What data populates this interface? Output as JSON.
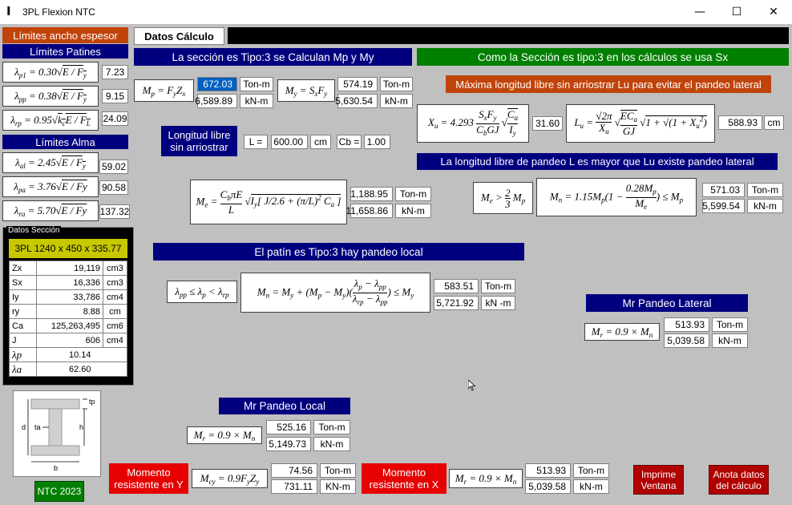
{
  "window": {
    "title": "3PL Flexion NTC",
    "minimize": "—",
    "maximize": "☐",
    "close": "✕"
  },
  "left": {
    "limits_header": "Límites ancho espesor",
    "patines_header": "Límites Patines",
    "alma_header": "Límites Alma",
    "patines": [
      {
        "formula": "λp1 = 0.30√(E / Fy)",
        "value": "7.23"
      },
      {
        "formula": "λpp = 0.38√(E / Fy)",
        "value": "9.15"
      },
      {
        "formula": "λrp = 0.95√(kc E / FL)",
        "value": "24.09"
      }
    ],
    "alma": [
      {
        "formula": "λal = 2.45√(E / Fy)",
        "value": "59.02"
      },
      {
        "formula": "λpa = 3.76√(E / Fy)",
        "value": "90.58"
      },
      {
        "formula": "λra = 5.70√(E / Fy)",
        "value": "137.32"
      }
    ],
    "section_panel_label": "Datos Sección",
    "section_name": "3PL 1240 x 450 x 335.77",
    "props": [
      {
        "name": "Zx",
        "value": "19,119",
        "unit": "cm3"
      },
      {
        "name": "Sx",
        "value": "16,336",
        "unit": "cm3"
      },
      {
        "name": "Iy",
        "value": "33,786",
        "unit": "cm4"
      },
      {
        "name": "ry",
        "value": "8.88",
        "unit": "cm"
      },
      {
        "name": "Ca",
        "value": "125,263,495",
        "unit": "cm6"
      },
      {
        "name": "J",
        "value": "606",
        "unit": "cm4"
      },
      {
        "name": "λp",
        "value": "10.14",
        "unit": ""
      },
      {
        "name": "λa",
        "value": "62.60",
        "unit": ""
      }
    ],
    "diagram_labels": {
      "tp": "tp",
      "d": "d",
      "ta": "ta",
      "h": "h",
      "b": "b"
    },
    "ntc_label": "NTC 2023"
  },
  "tab": {
    "label": "Datos Cálculo"
  },
  "banner_type": "La sección es Tipo:3 se Calculan Mp y My",
  "banner_sx": "Como la Sección es tipo:3 en los cálculos se usa Sx",
  "mp": {
    "formula": "Mp = Fy Zx",
    "v1": "672.03",
    "u1": "Ton-m",
    "v2": "6,589.89",
    "u2": "kN-m"
  },
  "my": {
    "formula": "My = Sx Fy",
    "v1": "574.19",
    "u1": "Ton-m",
    "v2": "5,630.54",
    "u2": "kN-m"
  },
  "lu": {
    "header": "Máxima longitud libre sin arriostrar Lu para evitar el pandeo lateral",
    "xu_formula": "Xu = 4.293 (Sx Fy / Cb GJ) √(Ca / Iy)",
    "xu_value": "31.60",
    "lu_formula": "Lu = (√2π / Xu) √(ECa / GJ) √(1 + √(1 + Xu²))",
    "lu_value": "588.93",
    "lu_unit": "cm"
  },
  "longitud": {
    "label": "Longitud libre sin arriostrar",
    "L_label": "L =",
    "L_value": "600.00",
    "L_unit": "cm",
    "Cb_label": "Cb =",
    "Cb_value": "1.00"
  },
  "me": {
    "formula": "Me = (Cb π E / L) √(Iy [J/2.6 + (π/L)² Ca])",
    "v1": "1,188.95",
    "u1": "Ton-m",
    "v2": "11,658.86",
    "u2": "kN-m"
  },
  "pandeo_lateral_msg": "La longitud libre de pandeo L es mayor que Lu existe pandeo lateral",
  "mn_lat": {
    "cond": "Me > (2/3) Mp",
    "formula": "Mn = 1.15 Mp (1 − 0.28Mp / Me) ≤ Mp",
    "v1": "571.03",
    "u1": "Ton-m",
    "v2": "5,599.54",
    "u2": "kN-m"
  },
  "patin_msg": "El patín es Tipo:3 hay pandeo local",
  "mn_loc": {
    "cond": "λpp ≤ λp < λrp",
    "formula": "Mn = My + (Mp − My)((λp − λpp)/(λrp − λpp)) ≤ My",
    "v1": "583.51",
    "u1": "Ton-m",
    "v2": "5,721.92",
    "u2": "kN -m"
  },
  "mr_lat": {
    "header": "Mr Pandeo Lateral",
    "formula": "Mr = 0.9 × Mn",
    "v1": "513.93",
    "u1": "Ton-m",
    "v2": "5,039.58",
    "u2": "kN-m"
  },
  "mr_loc": {
    "header": "Mr Pandeo Local",
    "formula": "Mr = 0.9 × Mn",
    "v1": "525.16",
    "u1": "Ton-m",
    "v2": "5,149.73",
    "u2": "kN-m"
  },
  "mom_y": {
    "label": "Momento resistente en Y",
    "formula": "Mcy = 0.9 Fy Zy",
    "v1": "74.56",
    "u1": "Ton-m",
    "v2": "731.11",
    "u2": "KN-m"
  },
  "mom_x": {
    "label": "Momento resistente en X",
    "formula": "Mr = 0.9 × Mn",
    "v1": "513.93",
    "u1": "Ton-m",
    "v2": "5,039.58",
    "u2": "kN-m"
  },
  "buttons": {
    "print": "Imprime Ventana",
    "note": "Anota datos del cálculo"
  },
  "colors": {
    "navy": "#00007f",
    "green": "#008000",
    "orange": "#c0440a",
    "red": "#e60000",
    "gray": "#c0c0c0",
    "yellow": "#c8c800"
  }
}
